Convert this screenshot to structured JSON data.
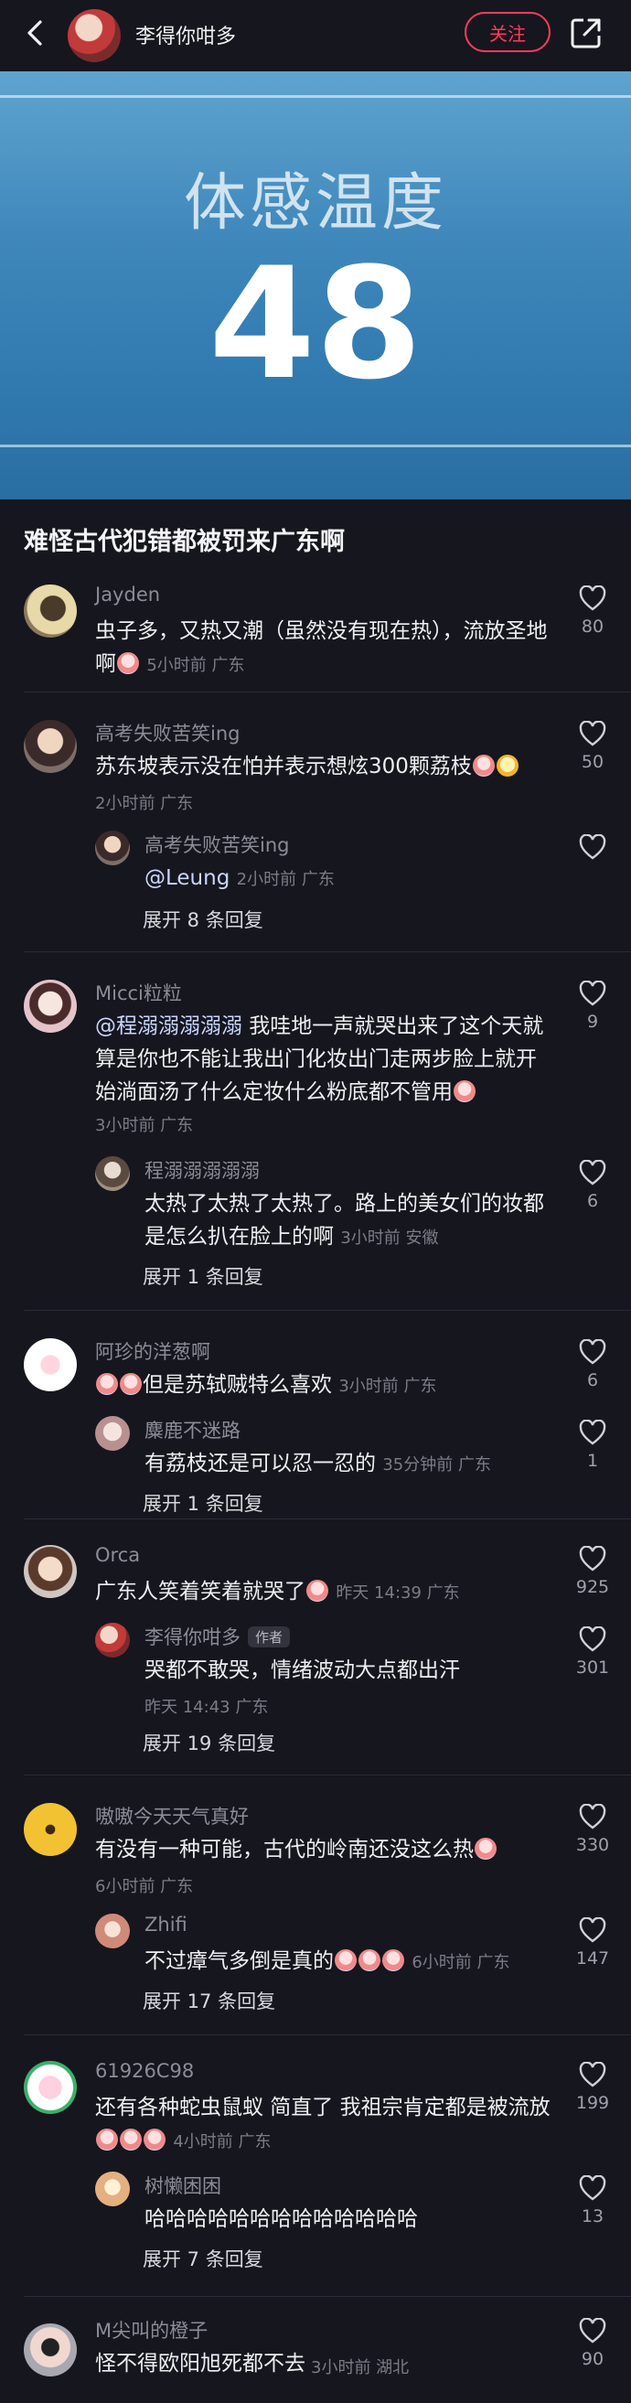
{
  "header": {
    "username": "李得你咁多",
    "follow_label": "关注"
  },
  "hero": {
    "label": "体感温度",
    "value": "48"
  },
  "post": {
    "title": "难怪古代犯错都被罚来广东啊"
  },
  "comments": [
    {
      "name": "Jayden",
      "text": "虫子多，又热又潮（虽然没有现在热），流放圣地啊",
      "time": "5小时前 广东",
      "likes": "80"
    },
    {
      "name": "高考失败苦笑ing",
      "text": "苏东坡表示没在怕并表示想炫300颗荔枝",
      "time": "2小时前 广东",
      "likes": "50",
      "reply": {
        "name": "高考失败苦笑ing",
        "mention": "@Leung",
        "time": "2小时前 广东",
        "likes": ""
      },
      "expand": "展开 8 条回复"
    },
    {
      "name": "Micci粒粒",
      "mention": "@程溺溺溺溺溺",
      "text": " 我哇地一声就哭出来了这个天就算是你也不能让我出门化妆出门走两步脸上就开始淌面汤了什么定妆什么粉底都不管用",
      "time": "3小时前 广东",
      "likes": "9",
      "reply": {
        "name": "程溺溺溺溺溺",
        "text": "太热了太热了太热了。路上的美女们的妆都是怎么扒在脸上的啊",
        "time": "3小时前 安徽",
        "likes": "6"
      },
      "expand": "展开 1 条回复"
    },
    {
      "name": "阿珍的洋葱啊",
      "text": "但是苏轼贼特么喜欢",
      "time": "3小时前 广东",
      "likes": "6",
      "reply": {
        "name": "麋鹿不迷路",
        "text": "有荔枝还是可以忍一忍的",
        "time": "35分钟前 广东",
        "likes": "1"
      },
      "expand": "展开 1 条回复"
    },
    {
      "name": "Orca",
      "text": "广东人笑着笑着就哭了",
      "time": "昨天 14:39 广东",
      "likes": "925",
      "reply": {
        "name": "李得你咁多",
        "tag": "作者",
        "text": "哭都不敢哭，情绪波动大点都出汗",
        "time": "昨天 14:43 广东",
        "likes": "301"
      },
      "expand": "展开 19 条回复"
    },
    {
      "name": "嗷嗷今天天气真好",
      "text": "有没有一种可能，古代的岭南还没这么热",
      "time": "6小时前 广东",
      "likes": "330",
      "reply": {
        "name": "Zhifi",
        "text": "不过瘴气多倒是真的",
        "time": "6小时前 广东",
        "likes": "147"
      },
      "expand": "展开 17 条回复"
    },
    {
      "name": "61926C98",
      "text": "还有各种蛇虫鼠蚁 简直了 我祖宗肯定都是被流放",
      "time": "4小时前 广东",
      "likes": "199",
      "reply": {
        "name": "树懒困困",
        "text": "哈哈哈哈哈哈哈哈哈哈哈哈哈",
        "time": "",
        "likes": "13"
      },
      "expand": "展开 7 条回复"
    },
    {
      "name": "M尖叫的橙子",
      "text": "怪不得欧阳旭死都不去",
      "time": "3小时前 湖北",
      "likes": "90"
    }
  ],
  "colors": {
    "accent": "#ff3b5c",
    "background": "#16161e"
  }
}
